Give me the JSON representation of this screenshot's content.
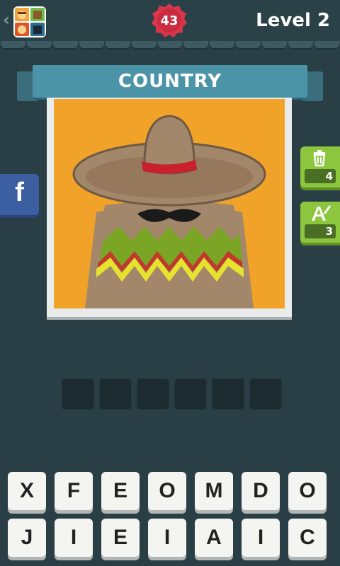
{
  "header": {
    "back_icon": "chevron-left-icon",
    "app_icon": "icon-pop-quiz-app-icon",
    "coins": "43",
    "level": "Level 2"
  },
  "category": "COUNTRY",
  "side_buttons": {
    "facebook": "f",
    "hints": [
      {
        "icon": "trash-icon",
        "count": "4"
      },
      {
        "icon": "letter-reveal-icon",
        "count": "3"
      }
    ]
  },
  "answer_slots": 6,
  "keyboard": {
    "row1": [
      "X",
      "F",
      "E",
      "O",
      "M",
      "D",
      "O"
    ],
    "row2": [
      "J",
      "I",
      "E",
      "I",
      "A",
      "I",
      "C"
    ]
  },
  "colors": {
    "background": "#2a3f45",
    "banner": "#4b94a8",
    "picture_bg": "#f0a229",
    "coin": "#d9364a",
    "hint_green": "#8cc63f",
    "facebook": "#3b5fa0"
  }
}
